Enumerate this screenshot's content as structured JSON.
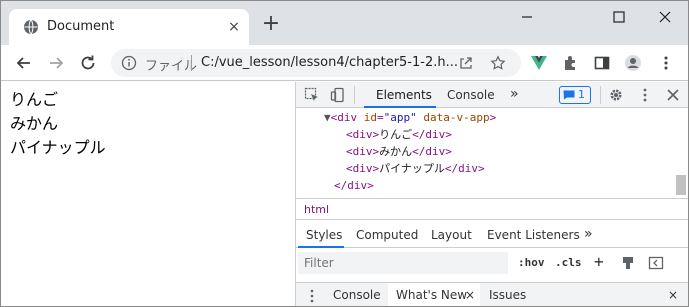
{
  "browser": {
    "tab": {
      "title": "Document",
      "close_glyph": "×",
      "favicon": "globe-icon"
    },
    "new_tab_glyph": "+",
    "address": {
      "security_label": "ファイル",
      "url": "C:/vue_lesson/lesson4/chapter5-1-2.h..."
    },
    "accent_colors": {
      "vue": "#41b883",
      "link": "#1a73e8"
    }
  },
  "page": {
    "lines": [
      "りんご",
      "みかん",
      "パイナップル"
    ]
  },
  "devtools": {
    "tabs": {
      "elements": "Elements",
      "console": "Console",
      "more": "»"
    },
    "issues_badge": "1",
    "dom": {
      "div_open_tag": "<div ",
      "attr_id_name": "id",
      "attr_id_eq": "=",
      "attr_id_value": "\"app\"",
      "attr_vapp": " data-v-app",
      "gt": ">",
      "tri": "▼",
      "children": [
        {
          "open": "<div>",
          "text": "りんご",
          "close": "</div>"
        },
        {
          "open": "<div>",
          "text": "みかん",
          "close": "</div>"
        },
        {
          "open": "<div>",
          "text": "パイナップル",
          "close": "</div>"
        }
      ],
      "div_close": "</div>"
    },
    "breadcrumb": "html",
    "styles_tabs": {
      "styles": "Styles",
      "computed": "Computed",
      "layout": "Layout",
      "event_listeners": "Event Listeners",
      "more": "»"
    },
    "filter": {
      "placeholder": "Filter",
      "hov": ":hov",
      "cls": ".cls",
      "add": "+"
    },
    "drawer": {
      "console": "Console",
      "whats_new": "What's New",
      "whats_new_close": "×",
      "issues": "Issues",
      "close": "×"
    }
  }
}
